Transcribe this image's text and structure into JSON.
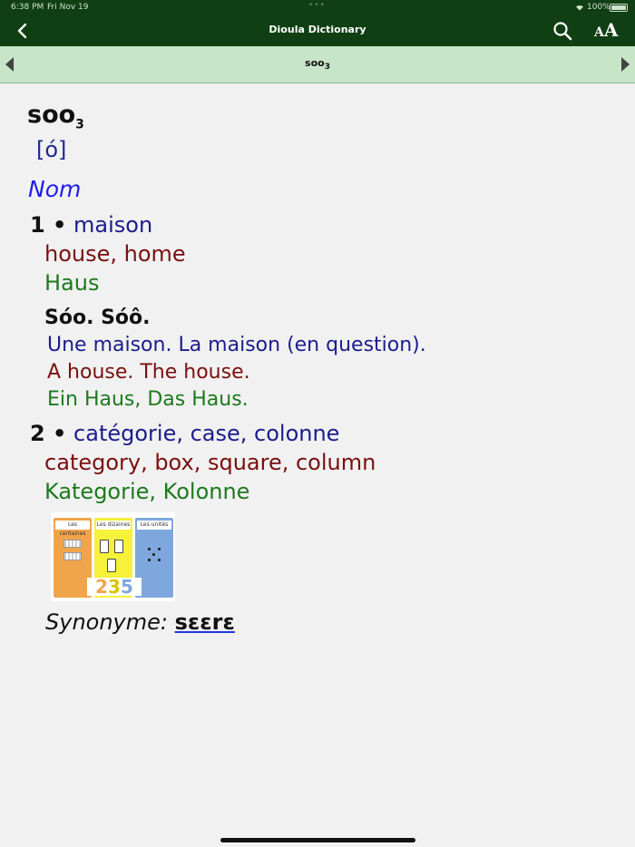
{
  "status": {
    "time": "6:38 PM",
    "date": "Fri Nov 19",
    "battery": "100%"
  },
  "nav": {
    "title": "Dioula Dictionary",
    "back_icon": "chevron-left-icon",
    "search_icon": "search-icon",
    "textsize_small": "A",
    "textsize_big": "A"
  },
  "entry_bar": {
    "headword": "soo",
    "homonym": "3"
  },
  "entry": {
    "lemma": "soo",
    "homonym": "3",
    "pronunciation": "[ó]",
    "pos": "Nom",
    "senses": [
      {
        "num": "1 •",
        "fr": "maison",
        "en": "house, home",
        "de": "Haus",
        "example": {
          "dioula": "Sóo. Sóô.",
          "fr": "Une maison. La maison (en question).",
          "en": "A house. The house.",
          "de": "Ein Haus, Das Haus."
        }
      },
      {
        "num": "2 •",
        "fr": "catégorie, case, colonne",
        "en": "category, box, square, column",
        "de": "Kategorie, Kolonne",
        "picture": {
          "labels": [
            "Les centaines",
            "Les dizaines",
            "Les unités"
          ],
          "digits": [
            "2",
            "3",
            "5"
          ],
          "colors": [
            "#f0a54b",
            "#f6f13a",
            "#7ea7de"
          ]
        }
      }
    ],
    "synonym_label": "Synonyme:",
    "synonym": "sɛɛrɛ"
  },
  "colors": {
    "nav": "#0f3f12",
    "entry_bar": "#c7e6c8",
    "french": "#1c1c8c",
    "english": "#7a0f0f",
    "german": "#1c7a1c"
  }
}
